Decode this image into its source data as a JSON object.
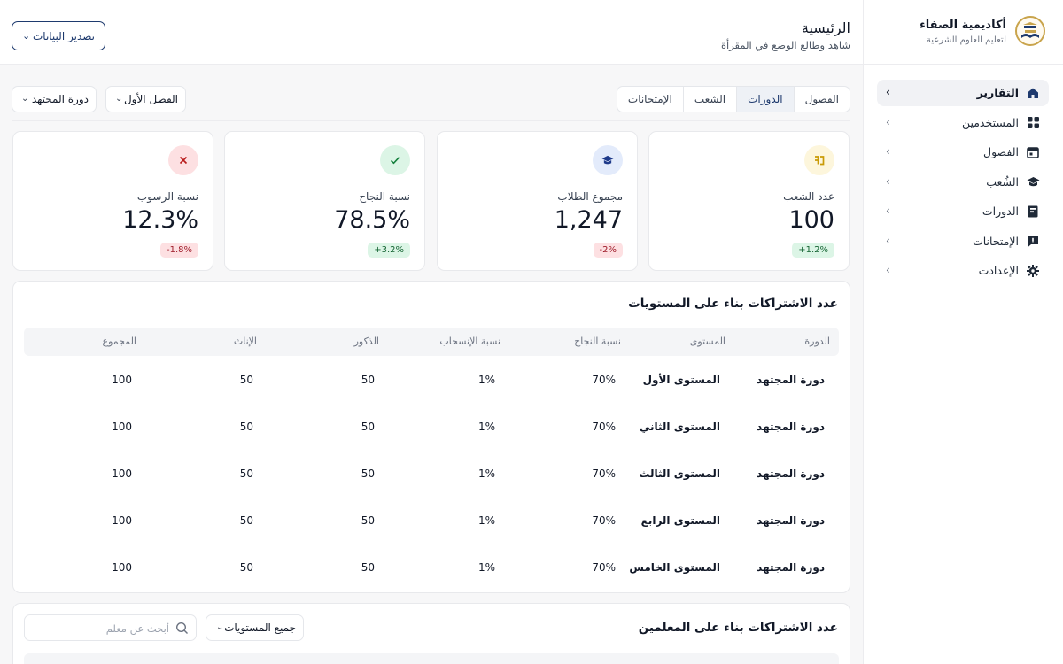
{
  "brand": {
    "name": "أكاديمية الصفاء",
    "subtitle": "لتعليم العلوم الشرعية"
  },
  "sidebar": {
    "items": [
      {
        "label": "التقارير",
        "icon": "home-icon",
        "active": true
      },
      {
        "label": "المستخدمين",
        "icon": "grid-icon",
        "active": false
      },
      {
        "label": "الفصول",
        "icon": "calendar-icon",
        "active": false
      },
      {
        "label": "الشُعب",
        "icon": "graduation-cap-icon",
        "active": false
      },
      {
        "label": "الدورات",
        "icon": "book-icon",
        "active": false
      },
      {
        "label": "الإمتحانات",
        "icon": "quiz-icon",
        "active": false
      },
      {
        "label": "الإعدادت",
        "icon": "gear-icon",
        "active": false
      }
    ]
  },
  "header": {
    "title": "الرئيسية",
    "subtitle": "شاهد وطالع الوضع في المقرأة",
    "export_label": "تصدير البيانات"
  },
  "tabs": [
    {
      "label": "الفصول",
      "active": false
    },
    {
      "label": "الدورات",
      "active": true
    },
    {
      "label": "الشعب",
      "active": false
    },
    {
      "label": "الإمتحانات",
      "active": false
    }
  ],
  "filters": {
    "semester": "الفصل الأول",
    "course": "دورة المجتهد"
  },
  "stats": [
    {
      "label": "عدد الشعب",
      "value": "100",
      "change": "+1.2%",
      "trend": "up",
      "icon": "sections-icon",
      "icon_bg": "#fdf6dc",
      "icon_color": "#c99a06"
    },
    {
      "label": "مجموع الطلاب",
      "value": "1,247",
      "change": "-2%",
      "trend": "down",
      "icon": "graduation-cap-icon",
      "icon_bg": "#e3ebfb",
      "icon_color": "#1e3a8a"
    },
    {
      "label": "نسبة النجاح",
      "value": "78.5%",
      "change": "+3.2%",
      "trend": "up",
      "icon": "check-icon",
      "icon_bg": "#dcf5e6",
      "icon_color": "#15803d"
    },
    {
      "label": "نسبة الرسوب",
      "value": "12.3%",
      "change": "-1.8%",
      "trend": "down",
      "icon": "x-icon",
      "icon_bg": "#fde0e2",
      "icon_color": "#b91c1c"
    }
  ],
  "levels_table": {
    "title": "عدد الاشتراكات بناء على المستويات",
    "columns": [
      "الدورة",
      "المستوى",
      "نسبة النجاح",
      "نسبة الإنسحاب",
      "الذكور",
      "الإناث",
      "المجموع"
    ],
    "rows": [
      [
        "دورة المجتهد",
        "المستوى الأول",
        "70%",
        "1%",
        "50",
        "50",
        "100"
      ],
      [
        "دورة المجتهد",
        "المستوى الثاني",
        "70%",
        "1%",
        "50",
        "50",
        "100"
      ],
      [
        "دورة المجتهد",
        "المستوى الثالث",
        "70%",
        "1%",
        "50",
        "50",
        "100"
      ],
      [
        "دورة المجتهد",
        "المستوى الرابع",
        "70%",
        "1%",
        "50",
        "50",
        "100"
      ],
      [
        "دورة المجتهد",
        "المستوى الخامس",
        "70%",
        "1%",
        "50",
        "50",
        "100"
      ]
    ]
  },
  "teachers_table": {
    "title": "عدد الاشتراكات بناء على المعلمين",
    "level_select": "جميع المستويات",
    "search_placeholder": "أبحث عن معلم"
  },
  "colors": {
    "accent": "#1e3a6e",
    "sidebar_active_bg": "#f1f2f5",
    "page_bg": "#f7f7f8"
  }
}
